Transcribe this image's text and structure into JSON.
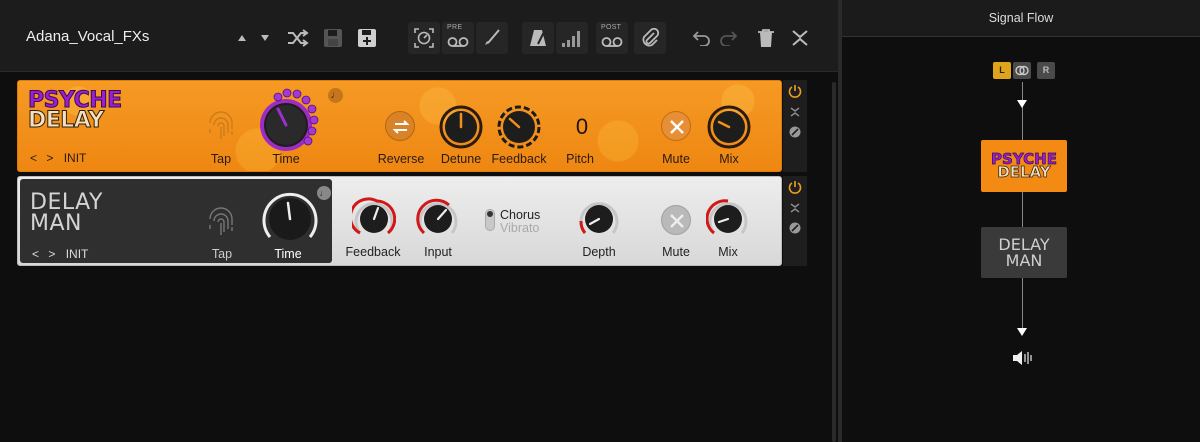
{
  "header": {
    "preset_name": "Adana_Vocal_FXs",
    "toolbar": [
      {
        "name": "preset-up",
        "icon": "triangle-up-icon"
      },
      {
        "name": "preset-down",
        "icon": "triangle-down-icon"
      },
      {
        "name": "shuffle",
        "icon": "shuffle-icon"
      },
      {
        "name": "save",
        "icon": "save-icon"
      },
      {
        "name": "save-as",
        "icon": "save-plus-icon"
      },
      {
        "name": "tuner",
        "icon": "tuner-icon"
      },
      {
        "name": "pre-tape",
        "label": "PRE",
        "icon": "tape-icon"
      },
      {
        "name": "guitar",
        "icon": "pick-icon"
      },
      {
        "name": "metronome",
        "icon": "metronome-icon"
      },
      {
        "name": "level-meter",
        "icon": "bars-icon"
      },
      {
        "name": "post-tape",
        "label": "POST",
        "icon": "tape-icon"
      },
      {
        "name": "attach",
        "icon": "paperclip-icon"
      },
      {
        "name": "undo",
        "icon": "undo-icon"
      },
      {
        "name": "redo",
        "icon": "redo-icon"
      },
      {
        "name": "delete",
        "icon": "trash-icon"
      },
      {
        "name": "collapse",
        "icon": "collapse-icon"
      }
    ],
    "pre_label": "PRE",
    "post_label": "POST"
  },
  "psyche_delay": {
    "logo_line1": "PSYCHE",
    "logo_line2": "DELAY",
    "preset_prev": "<",
    "preset_next": ">",
    "preset": "INIT",
    "tap_label": "Tap",
    "time_label": "Time",
    "reverse_label": "Reverse",
    "detune_label": "Detune",
    "feedback_label": "Feedback",
    "pitch_label": "Pitch",
    "pitch_value": "0",
    "mute_label": "Mute",
    "mix_label": "Mix",
    "accent_color": "#f39019"
  },
  "delay_man": {
    "logo_line1": "DELAY",
    "logo_line2": "MAN",
    "preset_prev": "<",
    "preset_next": ">",
    "preset": "INIT",
    "tap_label": "Tap",
    "time_label": "Time",
    "feedback_label": "Feedback",
    "input_label": "Input",
    "mode_option1": "Chorus",
    "mode_option2": "Vibrato",
    "depth_label": "Depth",
    "mute_label": "Mute",
    "mix_label": "Mix",
    "knob_accent_color": "#d01818"
  },
  "signal_flow": {
    "title": "Signal Flow",
    "channel_l": "L",
    "channel_r": "R",
    "psyche_line1": "PSYCHE",
    "psyche_line2": "DELAY",
    "delayman_line1": "DELAY",
    "delayman_line2": "MAN",
    "output_icon": "speaker-icon"
  },
  "colors": {
    "power_on": "#f0a020",
    "channel_active": "#e0a41a"
  }
}
